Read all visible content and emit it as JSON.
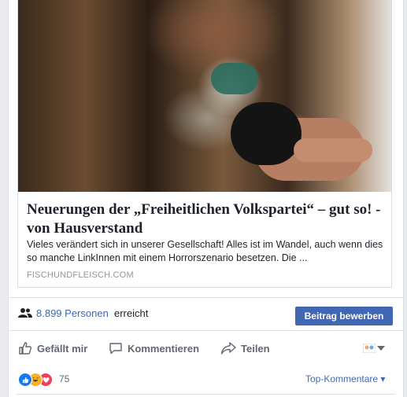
{
  "preview": {
    "title": "Neuerungen der „Freiheitlichen Volkspartei“ – gut so! - von Hausverstand",
    "description": "Vieles verändert sich in unserer Gesellschaft! Alles ist im Wandel, auch wenn dies so manche LinkInnen mit einem Horrorszenario besetzen. Die ...",
    "domain": "FISCHUNDFLEISCH.COM"
  },
  "reach": {
    "count": "8.899 Personen",
    "suffix": "erreicht",
    "boost_label": "Beitrag bewerben"
  },
  "actions": {
    "like": "Gefällt mir",
    "comment": "Kommentieren",
    "share": "Teilen"
  },
  "reactions": {
    "count": "75",
    "sort_label": "Top-Kommentare ▾"
  },
  "colors": {
    "accent": "#4267b2",
    "like_blue": "#1877f2",
    "love_red": "#f33e58",
    "haha_yellow": "#f7b125"
  }
}
